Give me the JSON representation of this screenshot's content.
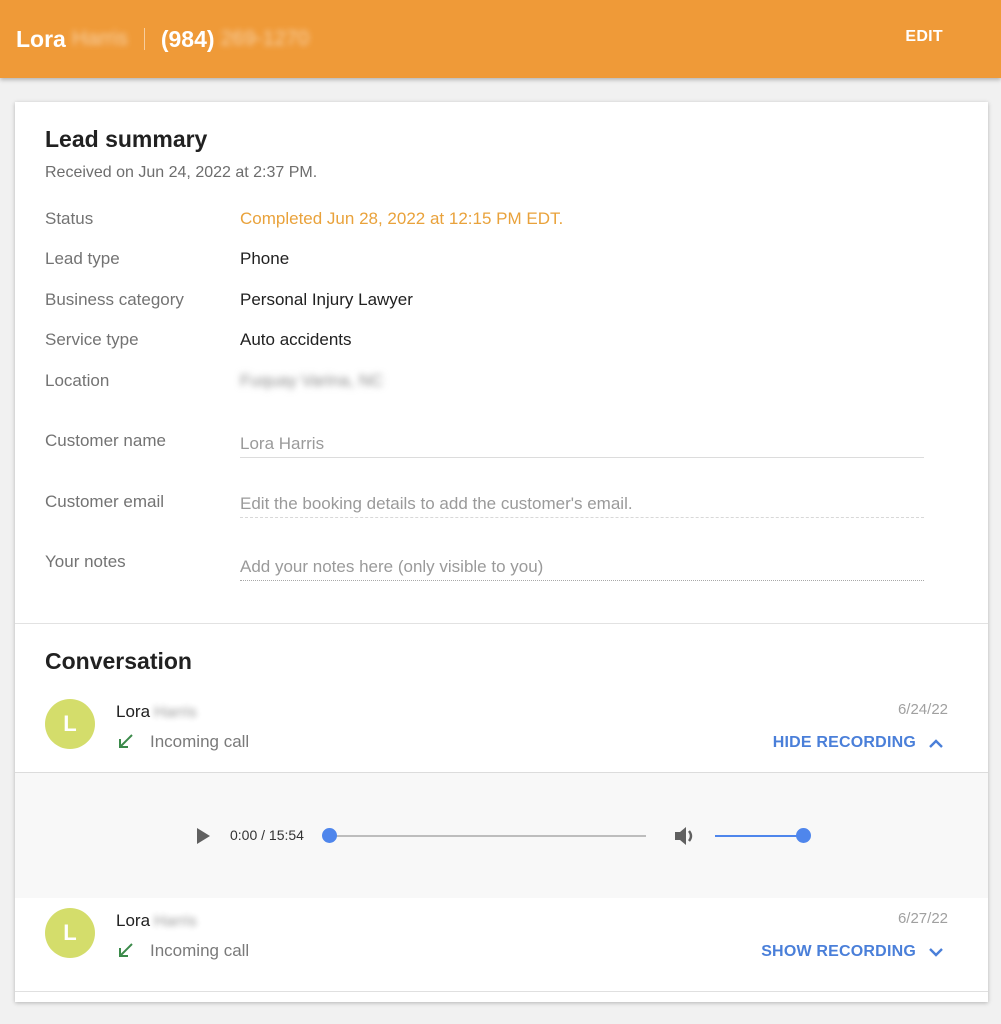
{
  "header": {
    "first_name": "Lora",
    "last_name_redacted": "Harris",
    "phone_area": "(984)",
    "phone_rest_redacted": "269-1270",
    "edit_label": "EDIT",
    "bar_color": "#ef9a38"
  },
  "summary": {
    "title": "Lead summary",
    "received": "Received on Jun 24, 2022 at 2:37 PM.",
    "rows": [
      {
        "label": "Status",
        "value": "Completed Jun 28, 2022 at 12:15 PM EDT."
      },
      {
        "label": "Lead type",
        "value": "Phone"
      },
      {
        "label": "Business category",
        "value": "Personal Injury Lawyer"
      },
      {
        "label": "Service type",
        "value": "Auto accidents"
      },
      {
        "label": "Location",
        "value": "Fuquay Varina, NC"
      }
    ],
    "fields": [
      {
        "label": "Customer name",
        "value": "Lora Harris",
        "placeholder": ""
      },
      {
        "label": "Customer email",
        "value": "",
        "placeholder": "Edit the booking details to add the customer's email."
      },
      {
        "label": "Your notes",
        "value": "",
        "placeholder": "Add your notes here (only visible to you)"
      }
    ],
    "status_color": "#e9a23b"
  },
  "conversation": {
    "title": "Conversation",
    "items": [
      {
        "avatar_letter": "L",
        "first_name": "Lora",
        "last_name_redacted": "Harris",
        "call_type": "Incoming call",
        "date": "6/24/22",
        "toggle_label": "HIDE RECORDING",
        "toggle_icon": "chevron-up-icon",
        "expanded": true
      },
      {
        "avatar_letter": "L",
        "first_name": "Lora",
        "last_name_redacted": "Harris",
        "call_type": "Incoming call",
        "date": "6/27/22",
        "toggle_label": "SHOW RECORDING",
        "toggle_icon": "chevron-down-icon",
        "expanded": false
      }
    ],
    "player": {
      "time_display": "0:00 / 15:54",
      "progress_fraction": 0.0,
      "volume_fraction": 1.0,
      "accent": "#4f86ec"
    },
    "avatar_color": "#d4dd6b",
    "link_color": "#4a7fd9"
  }
}
